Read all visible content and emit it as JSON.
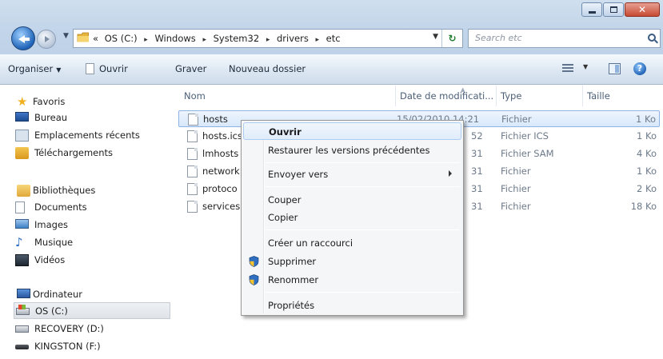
{
  "address": {
    "overflow": "«",
    "crumbs": [
      "OS (C:)",
      "Windows",
      "System32",
      "drivers",
      "etc"
    ],
    "separator": "▸",
    "refresh_icon": "refresh-icon",
    "search_placeholder": "Search etc"
  },
  "toolbar": {
    "organize": "Organiser",
    "open": "Ouvrir",
    "burn": "Graver",
    "new_folder": "Nouveau dossier"
  },
  "sidebar": {
    "favorites": "Favoris",
    "favorites_items": [
      "Bureau",
      "Emplacements récents",
      "Téléchargements"
    ],
    "libraries": "Bibliothèques",
    "library_items": [
      "Documents",
      "Images",
      "Musique",
      "Vidéos"
    ],
    "computer": "Ordinateur",
    "computer_items": [
      "OS (C:)",
      "RECOVERY (D:)",
      "KINGSTON (F:)"
    ]
  },
  "columns": {
    "name": "Nom",
    "date": "Date de modificati...",
    "type": "Type",
    "size": "Taille"
  },
  "files": [
    {
      "name": "hosts",
      "date": "15/02/2010 14:21",
      "type": "Fichier",
      "size": "1 Ko"
    },
    {
      "name": "hosts.ics",
      "date": "52",
      "type": "Fichier ICS",
      "size": "1 Ko"
    },
    {
      "name": "lmhosts",
      "date": "31",
      "type": "Fichier SAM",
      "size": "4 Ko"
    },
    {
      "name": "network",
      "date": "31",
      "type": "Fichier",
      "size": "1 Ko"
    },
    {
      "name": "protoco",
      "date": "31",
      "type": "Fichier",
      "size": "2 Ko"
    },
    {
      "name": "services",
      "date": "31",
      "type": "Fichier",
      "size": "18 Ko"
    }
  ],
  "context_menu": {
    "open": "Ouvrir",
    "restore": "Restaurer les versions précédentes",
    "send_to": "Envoyer vers",
    "cut": "Couper",
    "copy": "Copier",
    "shortcut": "Créer un raccourci",
    "delete": "Supprimer",
    "rename": "Renommer",
    "properties": "Propriétés"
  }
}
